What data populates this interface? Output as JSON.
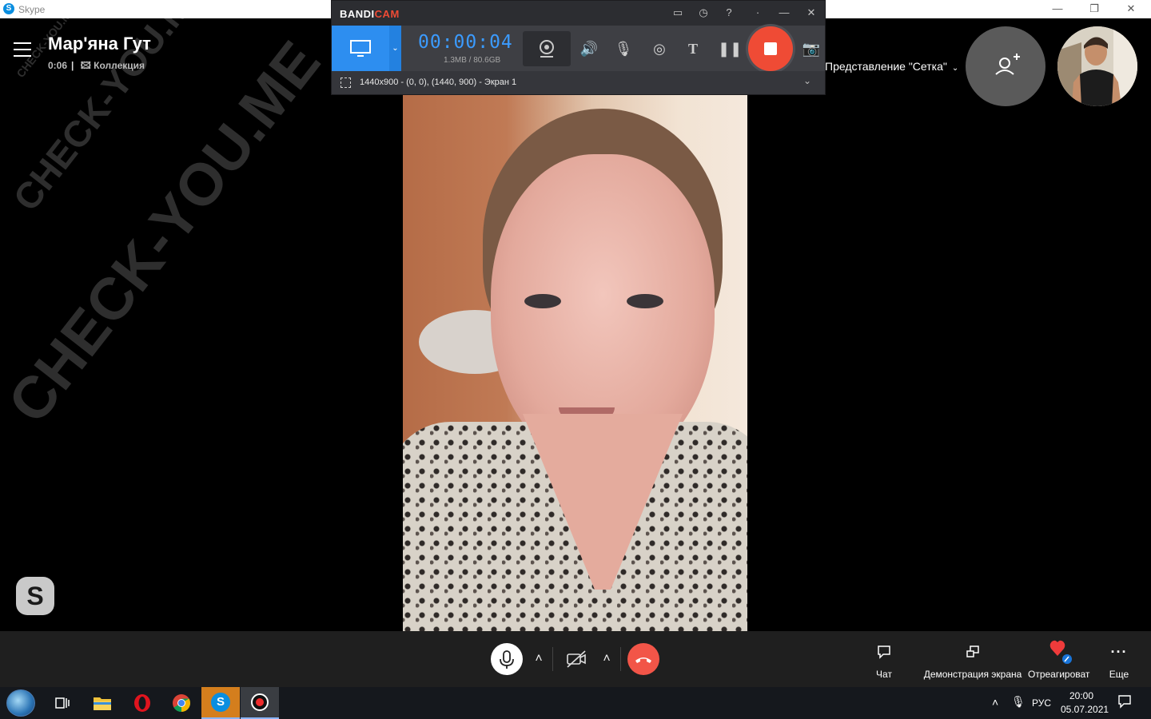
{
  "skype_window": {
    "title": "Skype",
    "controls": {
      "minimize": "—",
      "restore": "❐",
      "close": "✕"
    }
  },
  "call": {
    "contact_name": "Мар'яна Гут",
    "duration": "0:06",
    "collection_label": "Коллекция",
    "view_mode": "Представление \"Сетка\""
  },
  "watermark": {
    "text_large": "CHECK-YOU.ME",
    "text_small": "CHECK-YOU.ME"
  },
  "bandicam": {
    "logo_part1": "BANDI",
    "logo_part2": "CAM",
    "timer": "00:00:04",
    "file_size": "1.3MB / 80.6GB",
    "region_label": "1440x900 - (0, 0), (1440, 900) - Экран 1",
    "stop_color": "#ef4b35",
    "accent_color": "#2d8ef0"
  },
  "controls": {
    "chat_label": "Чат",
    "screen_share_label": "Демонстрация экрана",
    "react_label": "Отреагироват",
    "more_label": "Еще",
    "hangup_color": "#f25548"
  },
  "taskbar": {
    "language": "РУС",
    "time": "20:00",
    "date": "05.07.2021",
    "apps": [
      "task-view",
      "file-explorer",
      "opera",
      "chrome",
      "skype",
      "bandicam"
    ]
  }
}
